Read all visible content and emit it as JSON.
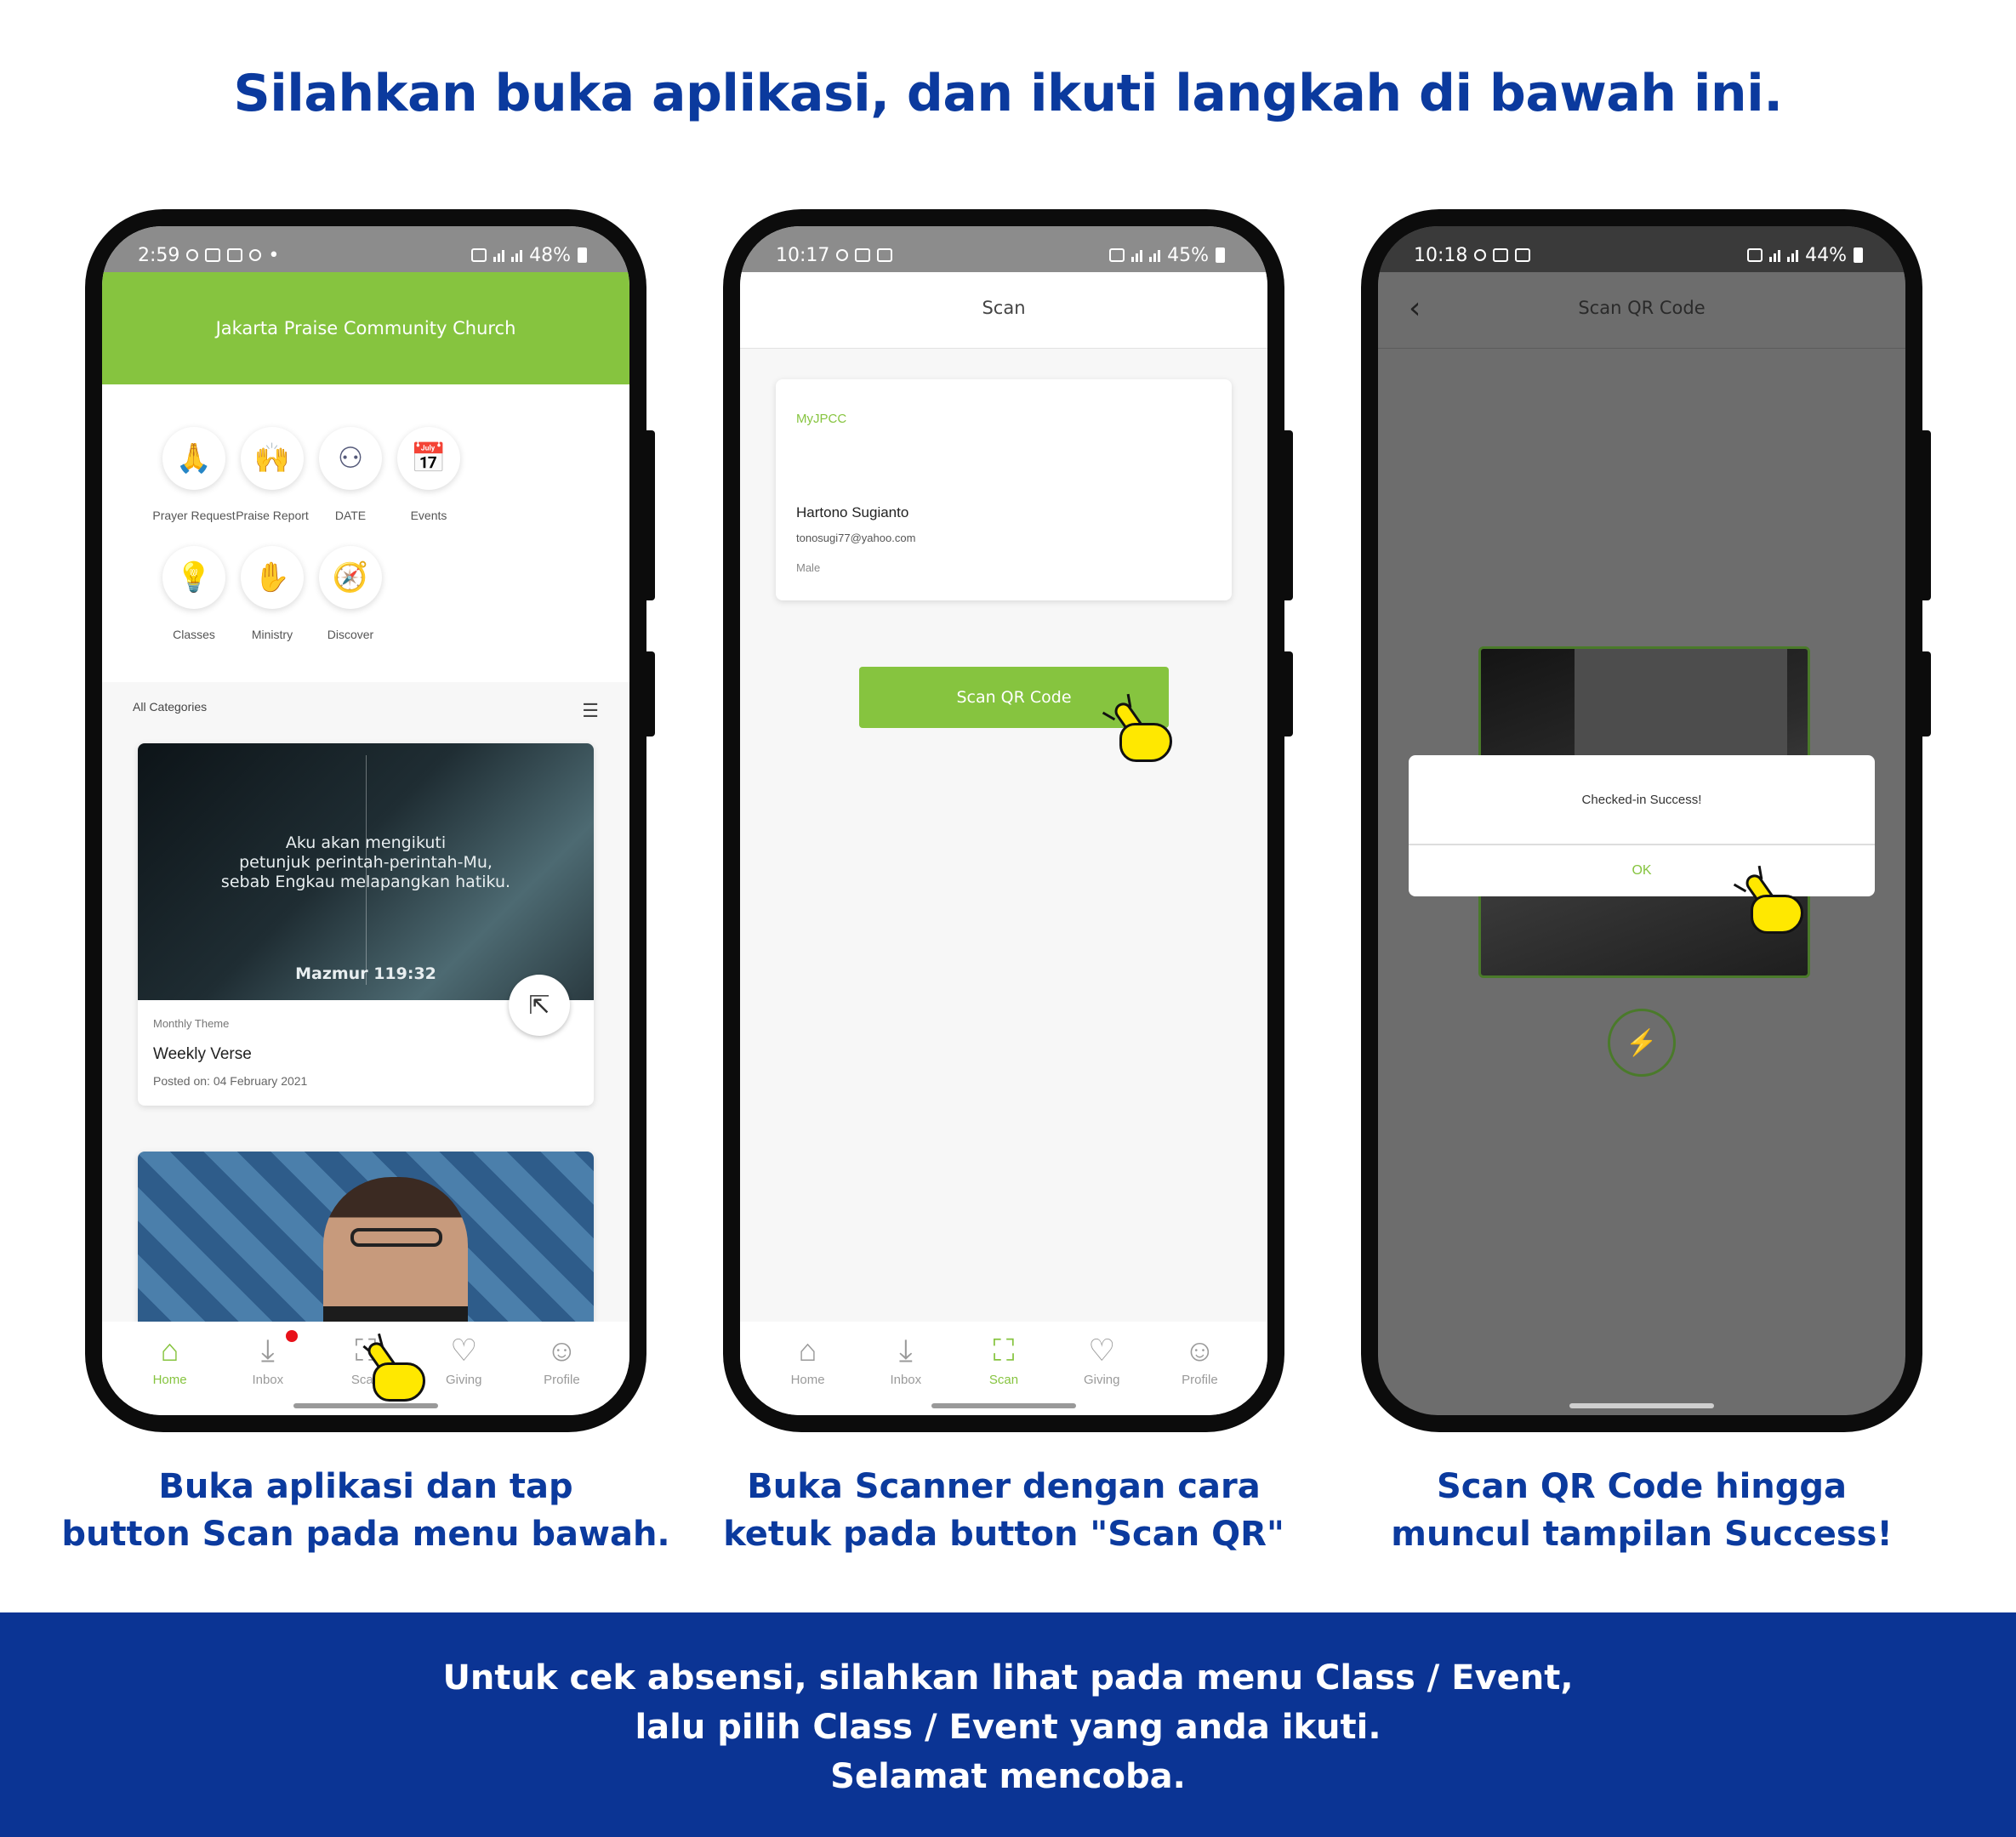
{
  "headline": {
    "pre": "Silahkan ",
    "bold": "buka aplikasi",
    "post": ", dan ikuti langkah di bawah ini."
  },
  "phone1": {
    "status": {
      "time": "2:59",
      "battery": "48%"
    },
    "church": "Jakarta Praise Community Church",
    "menu": [
      {
        "label": "Prayer Request",
        "icon": "praying-hands-icon",
        "glyph": "🙏",
        "color": "#4a7fc1"
      },
      {
        "label": "Praise Report",
        "icon": "raised-arms-icon",
        "glyph": "🙌",
        "color": "#2c5aa0"
      },
      {
        "label": "DATE",
        "icon": "people-circle-icon",
        "glyph": "⚇",
        "color": "#555a7a"
      },
      {
        "label": "Events",
        "icon": "calendar-icon",
        "glyph": "📅",
        "color": "#b34a5a"
      },
      {
        "label": "Classes",
        "icon": "lightbulb-icon",
        "glyph": "💡",
        "color": "#c0603a"
      },
      {
        "label": "Ministry",
        "icon": "hands-icon",
        "glyph": "✋",
        "color": "#8a4aa0"
      },
      {
        "label": "Discover",
        "icon": "compass-icon",
        "glyph": "🧭",
        "color": "#d88a2a"
      }
    ],
    "categories_label": "All Categories",
    "card": {
      "verse": [
        "Aku akan mengikuti",
        "petunjuk perintah-perintah-Mu,",
        "sebab Engkau melapangkan hatiku."
      ],
      "reference": "Mazmur 119:32",
      "theme": "Monthly Theme",
      "title": "Weekly Verse",
      "posted": "Posted on: 04 February 2021"
    },
    "nav": [
      {
        "label": "Home",
        "icon": "home-icon",
        "glyph": "⌂",
        "active": true
      },
      {
        "label": "Inbox",
        "icon": "inbox-icon",
        "glyph": "⤓",
        "active": false,
        "badge": true
      },
      {
        "label": "Scan",
        "icon": "scan-icon",
        "glyph": "⛶",
        "active": false
      },
      {
        "label": "Giving",
        "icon": "giving-icon",
        "glyph": "♡",
        "active": false
      },
      {
        "label": "Profile",
        "icon": "profile-icon",
        "glyph": "☺",
        "active": false
      }
    ]
  },
  "phone2": {
    "status": {
      "time": "10:17",
      "battery": "45%"
    },
    "title": "Scan",
    "profile": {
      "brand": "MyJPCC",
      "name": "Hartono Sugianto",
      "email": "tonosugi77@yahoo.com",
      "gender": "Male"
    },
    "scan_button": "Scan QR Code",
    "nav": [
      {
        "label": "Home",
        "icon": "home-icon",
        "glyph": "⌂",
        "active": false
      },
      {
        "label": "Inbox",
        "icon": "inbox-icon",
        "glyph": "⤓",
        "active": false
      },
      {
        "label": "Scan",
        "icon": "scan-icon",
        "glyph": "⛶",
        "active": true
      },
      {
        "label": "Giving",
        "icon": "giving-icon",
        "glyph": "♡",
        "active": false
      },
      {
        "label": "Profile",
        "icon": "profile-icon",
        "glyph": "☺",
        "active": false
      }
    ]
  },
  "phone3": {
    "status": {
      "time": "10:18",
      "battery": "44%"
    },
    "title": "Scan QR Code",
    "dialog": {
      "message": "Checked-in Success!",
      "ok": "OK"
    }
  },
  "captions": [
    [
      "Buka aplikasi dan tap",
      "button Scan pada menu bawah."
    ],
    [
      "Buka Scanner dengan cara",
      "ketuk pada button \"Scan QR\""
    ],
    [
      "Scan QR Code hingga",
      "muncul tampilan Success!"
    ]
  ],
  "footer": [
    "Untuk cek absensi, silahkan lihat pada menu Class / Event,",
    "lalu pilih Class / Event yang anda ikuti.",
    "Selamat mencoba."
  ],
  "colors": {
    "accent_green": "#86c43f",
    "brand_blue": "#0b3a9e",
    "footer_blue": "#0b3494"
  }
}
